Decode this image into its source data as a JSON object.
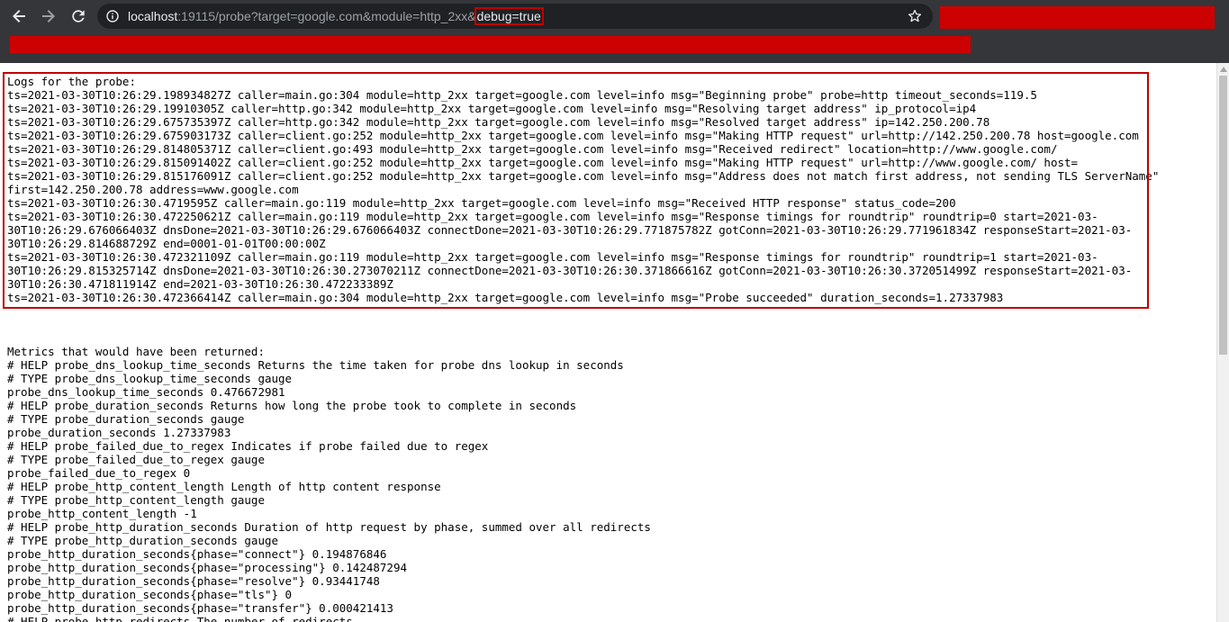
{
  "browser": {
    "url_host": "localhost",
    "url_rest_before": ":19115/probe?target=google.com&module=http_2xx&",
    "url_highlight": "debug=true",
    "icons": {
      "back": "back-arrow-icon",
      "forward": "forward-arrow-icon",
      "reload": "reload-icon",
      "info": "info-icon",
      "bookmark": "star-icon"
    },
    "redaction_color": "#cc0000",
    "highlight_color": "#c00000"
  },
  "logs": {
    "lines": [
      "Logs for the probe:",
      "ts=2021-03-30T10:26:29.198934827Z caller=main.go:304 module=http_2xx target=google.com level=info msg=\"Beginning probe\" probe=http timeout_seconds=119.5",
      "ts=2021-03-30T10:26:29.19910305Z caller=http.go:342 module=http_2xx target=google.com level=info msg=\"Resolving target address\" ip_protocol=ip4",
      "ts=2021-03-30T10:26:29.675735397Z caller=http.go:342 module=http_2xx target=google.com level=info msg=\"Resolved target address\" ip=142.250.200.78",
      "ts=2021-03-30T10:26:29.675903173Z caller=client.go:252 module=http_2xx target=google.com level=info msg=\"Making HTTP request\" url=http://142.250.200.78 host=google.com",
      "ts=2021-03-30T10:26:29.814805371Z caller=client.go:493 module=http_2xx target=google.com level=info msg=\"Received redirect\" location=http://www.google.com/",
      "ts=2021-03-30T10:26:29.815091402Z caller=client.go:252 module=http_2xx target=google.com level=info msg=\"Making HTTP request\" url=http://www.google.com/ host=",
      "ts=2021-03-30T10:26:29.815176091Z caller=client.go:252 module=http_2xx target=google.com level=info msg=\"Address does not match first address, not sending TLS ServerName\"",
      "first=142.250.200.78 address=www.google.com",
      "ts=2021-03-30T10:26:30.4719595Z caller=main.go:119 module=http_2xx target=google.com level=info msg=\"Received HTTP response\" status_code=200",
      "ts=2021-03-30T10:26:30.472250621Z caller=main.go:119 module=http_2xx target=google.com level=info msg=\"Response timings for roundtrip\" roundtrip=0 start=2021-03-",
      "30T10:26:29.676066403Z dnsDone=2021-03-30T10:26:29.676066403Z connectDone=2021-03-30T10:26:29.771875782Z gotConn=2021-03-30T10:26:29.771961834Z responseStart=2021-03-",
      "30T10:26:29.814688729Z end=0001-01-01T00:00:00Z",
      "ts=2021-03-30T10:26:30.472321109Z caller=main.go:119 module=http_2xx target=google.com level=info msg=\"Response timings for roundtrip\" roundtrip=1 start=2021-03-",
      "30T10:26:29.815325714Z dnsDone=2021-03-30T10:26:30.273070211Z connectDone=2021-03-30T10:26:30.371866616Z gotConn=2021-03-30T10:26:30.372051499Z responseStart=2021-03-",
      "30T10:26:30.471811914Z end=2021-03-30T10:26:30.472233389Z",
      "ts=2021-03-30T10:26:30.472366414Z caller=main.go:304 module=http_2xx target=google.com level=info msg=\"Probe succeeded\" duration_seconds=1.27337983"
    ]
  },
  "metrics": {
    "lines": [
      "Metrics that would have been returned:",
      "# HELP probe_dns_lookup_time_seconds Returns the time taken for probe dns lookup in seconds",
      "# TYPE probe_dns_lookup_time_seconds gauge",
      "probe_dns_lookup_time_seconds 0.476672981",
      "# HELP probe_duration_seconds Returns how long the probe took to complete in seconds",
      "# TYPE probe_duration_seconds gauge",
      "probe_duration_seconds 1.27337983",
      "# HELP probe_failed_due_to_regex Indicates if probe failed due to regex",
      "# TYPE probe_failed_due_to_regex gauge",
      "probe_failed_due_to_regex 0",
      "# HELP probe_http_content_length Length of http content response",
      "# TYPE probe_http_content_length gauge",
      "probe_http_content_length -1",
      "# HELP probe_http_duration_seconds Duration of http request by phase, summed over all redirects",
      "# TYPE probe_http_duration_seconds gauge",
      "probe_http_duration_seconds{phase=\"connect\"} 0.194876846",
      "probe_http_duration_seconds{phase=\"processing\"} 0.142487294",
      "probe_http_duration_seconds{phase=\"resolve\"} 0.93441748",
      "probe_http_duration_seconds{phase=\"tls\"} 0",
      "probe_http_duration_seconds{phase=\"transfer\"} 0.000421413",
      "# HELP probe_http_redirects The number of redirects"
    ]
  }
}
